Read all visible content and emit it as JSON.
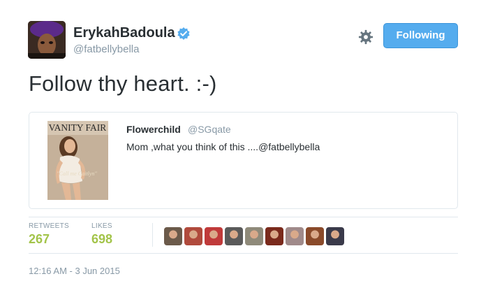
{
  "author": {
    "display_name": "ErykahBadoula",
    "handle": "@fatbellybella",
    "verified": true
  },
  "header": {
    "settings_icon": "gear-icon",
    "follow_button_label": "Following"
  },
  "tweet": {
    "text": "Follow thy heart. :-)",
    "timestamp": "12:16 AM - 3 Jun 2015"
  },
  "quoted_tweet": {
    "display_name": "Flowerchild",
    "handle": "@SGqate",
    "text": "Mom ,what you think of this ....@fatbellybella",
    "media": {
      "masthead": "VANITY FAIR",
      "cover_line": "\"Call me Caitlyn\""
    }
  },
  "stats": {
    "retweets_label": "RETWEETS",
    "retweets_count": "267",
    "likes_label": "LIKES",
    "likes_count": "698"
  },
  "likers": [
    {
      "color": "#6b5a4a"
    },
    {
      "color": "#b04a3c"
    },
    {
      "color": "#c03a3a"
    },
    {
      "color": "#5a5a5a"
    },
    {
      "color": "#8f8a7a"
    },
    {
      "color": "#7a2a1c"
    },
    {
      "color": "#a08a8a"
    },
    {
      "color": "#8a4a2a"
    },
    {
      "color": "#3a3a4a"
    }
  ],
  "colors": {
    "accent": "#55acee",
    "stat_value": "#a3c44a",
    "muted": "#8899a6",
    "text": "#292f33",
    "border": "#e1e8ed"
  }
}
